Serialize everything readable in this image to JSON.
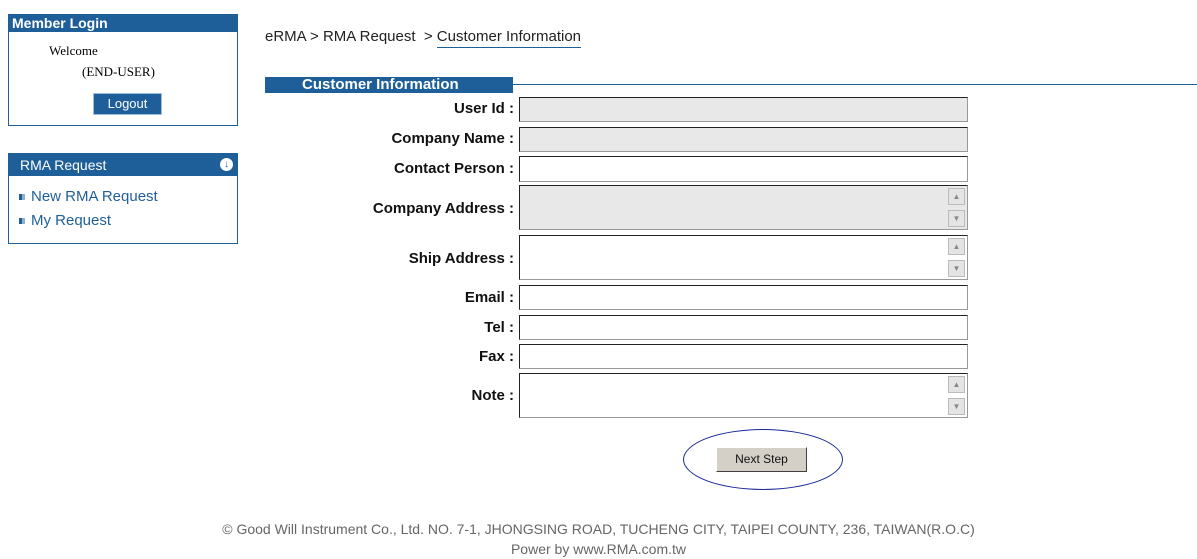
{
  "sidebar": {
    "member_login": {
      "title": "Member Login",
      "welcome": "Welcome",
      "user": "(END-USER)",
      "logout_label": "Logout"
    },
    "rma_request": {
      "title": "RMA Request",
      "icon": "circle-down-arrow-icon",
      "items": [
        {
          "label": "New RMA Request"
        },
        {
          "label": "My Request"
        }
      ]
    }
  },
  "breadcrumb": {
    "part1": "eRMA",
    "sep1": ">",
    "part2": "RMA Request",
    "sep2": ">",
    "current": "Customer Information"
  },
  "section": {
    "title": "Customer Information"
  },
  "form": {
    "user_id": {
      "label": "User Id :",
      "value": ""
    },
    "company_name": {
      "label": "Company Name :",
      "value": ""
    },
    "contact_person": {
      "label": "Contact Person :",
      "value": ""
    },
    "company_address": {
      "label": "Company Address :",
      "value": ""
    },
    "ship_address": {
      "label": "Ship Address :",
      "value": ""
    },
    "email": {
      "label": "Email :",
      "value": ""
    },
    "tel": {
      "label": "Tel :",
      "value": ""
    },
    "fax": {
      "label": "Fax :",
      "value": ""
    },
    "note": {
      "label": "Note :",
      "value": ""
    }
  },
  "actions": {
    "next_step_label": "Next Step"
  },
  "footer": {
    "line1": "© Good Will Instrument Co., Ltd. NO. 7-1, JHONGSING ROAD, TUCHENG CITY, TAIPEI COUNTY, 236, TAIWAN(R.O.C)",
    "line2": "Power by www.RMA.com.tw"
  },
  "colors": {
    "accent": "#1f5f99",
    "readonly_bg": "#e8e8e8",
    "ellipse": "#1a2a9a"
  }
}
